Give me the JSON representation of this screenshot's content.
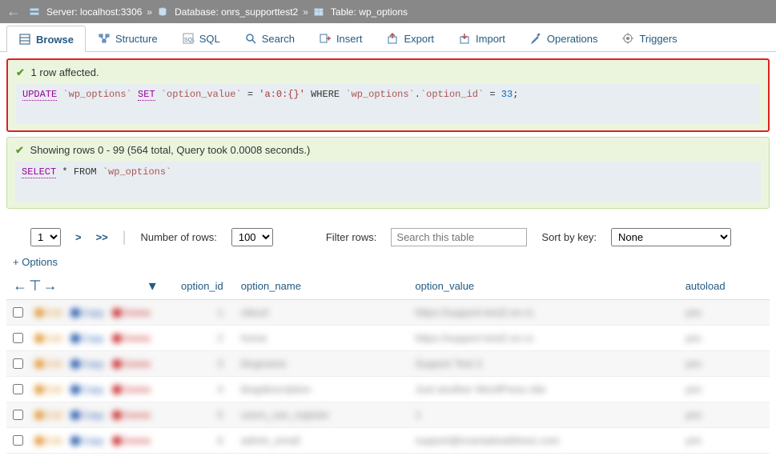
{
  "breadcrumb": {
    "server_label": "Server:",
    "server_value": "localhost:3306",
    "database_label": "Database:",
    "database_value": "onrs_supporttest2",
    "table_label": "Table:",
    "table_value": "wp_options"
  },
  "tabs": {
    "browse": "Browse",
    "structure": "Structure",
    "sql": "SQL",
    "search": "Search",
    "insert": "Insert",
    "export": "Export",
    "import": "Import",
    "operations": "Operations",
    "triggers": "Triggers"
  },
  "msg1": {
    "text": "1 row affected.",
    "sql_update": "UPDATE",
    "sql_table": "`wp_options`",
    "sql_set": "SET",
    "sql_col": "`option_value`",
    "sql_eq": "=",
    "sql_val": "'a:0:{}'",
    "sql_where": "WHERE",
    "sql_table2": "`wp_options`",
    "sql_dot": ".",
    "sql_col2": "`option_id`",
    "sql_eq2": "=",
    "sql_num": "33",
    "sql_semi": ";"
  },
  "msg2": {
    "text": "Showing rows 0 - 99 (564 total, Query took 0.0008 seconds.)",
    "sql_select": "SELECT",
    "sql_star": "*",
    "sql_from": "FROM",
    "sql_table": "`wp_options`"
  },
  "pagination": {
    "page_select_value": "1",
    "next": ">",
    "last": ">>",
    "num_rows_label": "Number of rows:",
    "num_rows_value": "100",
    "filter_label": "Filter rows:",
    "filter_placeholder": "Search this table",
    "sort_label": "Sort by key:",
    "sort_value": "None"
  },
  "options_link": "+ Options",
  "columns": {
    "option_id": "option_id",
    "option_name": "option_name",
    "option_value": "option_value",
    "autoload": "autoload"
  },
  "row_actions": {
    "edit": "Edit",
    "copy": "Copy",
    "delete": "Delete"
  },
  "rows": [
    {
      "id": "1",
      "name": "siteurl",
      "value": "https://support-test2.on.rs",
      "autoload": "yes"
    },
    {
      "id": "2",
      "name": "home",
      "value": "https://support-test2.on.rs",
      "autoload": "yes"
    },
    {
      "id": "3",
      "name": "blogname",
      "value": "Support Test 2",
      "autoload": "yes"
    },
    {
      "id": "4",
      "name": "blogdescription",
      "value": "Just another WordPress site",
      "autoload": "yes"
    },
    {
      "id": "5",
      "name": "users_can_register",
      "value": "1",
      "autoload": "yes"
    },
    {
      "id": "6",
      "name": "admin_email",
      "value": "support@exampleaddress.com",
      "autoload": "yes"
    }
  ]
}
